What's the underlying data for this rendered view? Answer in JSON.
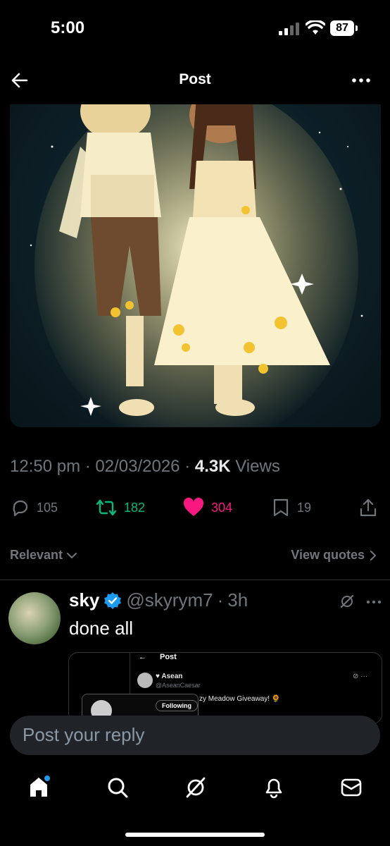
{
  "status_bar": {
    "time": "5:00",
    "battery": "87"
  },
  "nav": {
    "title": "Post"
  },
  "post": {
    "time": "12:50 pm",
    "date": "02/03/2026",
    "views_count": "4.3K",
    "views_label": "Views",
    "replies": "105",
    "reposts": "182",
    "likes": "304",
    "bookmarks": "19"
  },
  "sort": {
    "label": "Relevant",
    "view_quotes": "View quotes"
  },
  "reply": {
    "name": "sky",
    "handle": "@skyrym7",
    "age": "3h",
    "text": "done all",
    "embed": {
      "title": "Post",
      "name": "Asean",
      "handle": "@AseanCaesar",
      "follow_label": "Following",
      "snippet": "zy Meadow Giveaway! 🌻"
    }
  },
  "compose": {
    "placeholder": "Post your reply"
  },
  "colors": {
    "retweet": "#00ba7c",
    "like": "#f91880",
    "verified": "#1d9bf0"
  }
}
